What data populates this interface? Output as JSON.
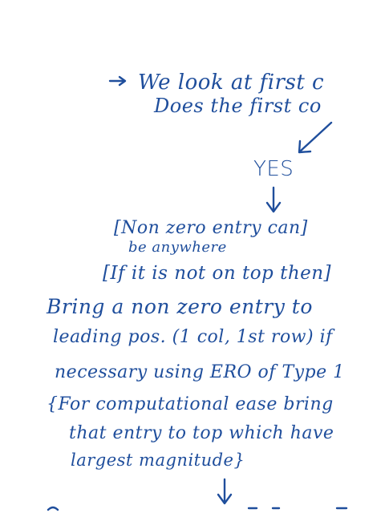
{
  "ink_color": "#1f4e9c",
  "lines": {
    "l1": "We look at first c",
    "l2": "Does the first co",
    "yes": "YES",
    "l4": "[Non zero entry can]",
    "l5": "be anywhere",
    "l6": "[If it is not on top then]",
    "l7": "Bring a non zero entry to",
    "l8": "leading pos. (1 col, 1st row) if",
    "l9": "necessary using ERO of Type 1",
    "l10": "{For computational ease bring",
    "l11": "that entry to top which have",
    "l12": "largest magnitude}"
  }
}
